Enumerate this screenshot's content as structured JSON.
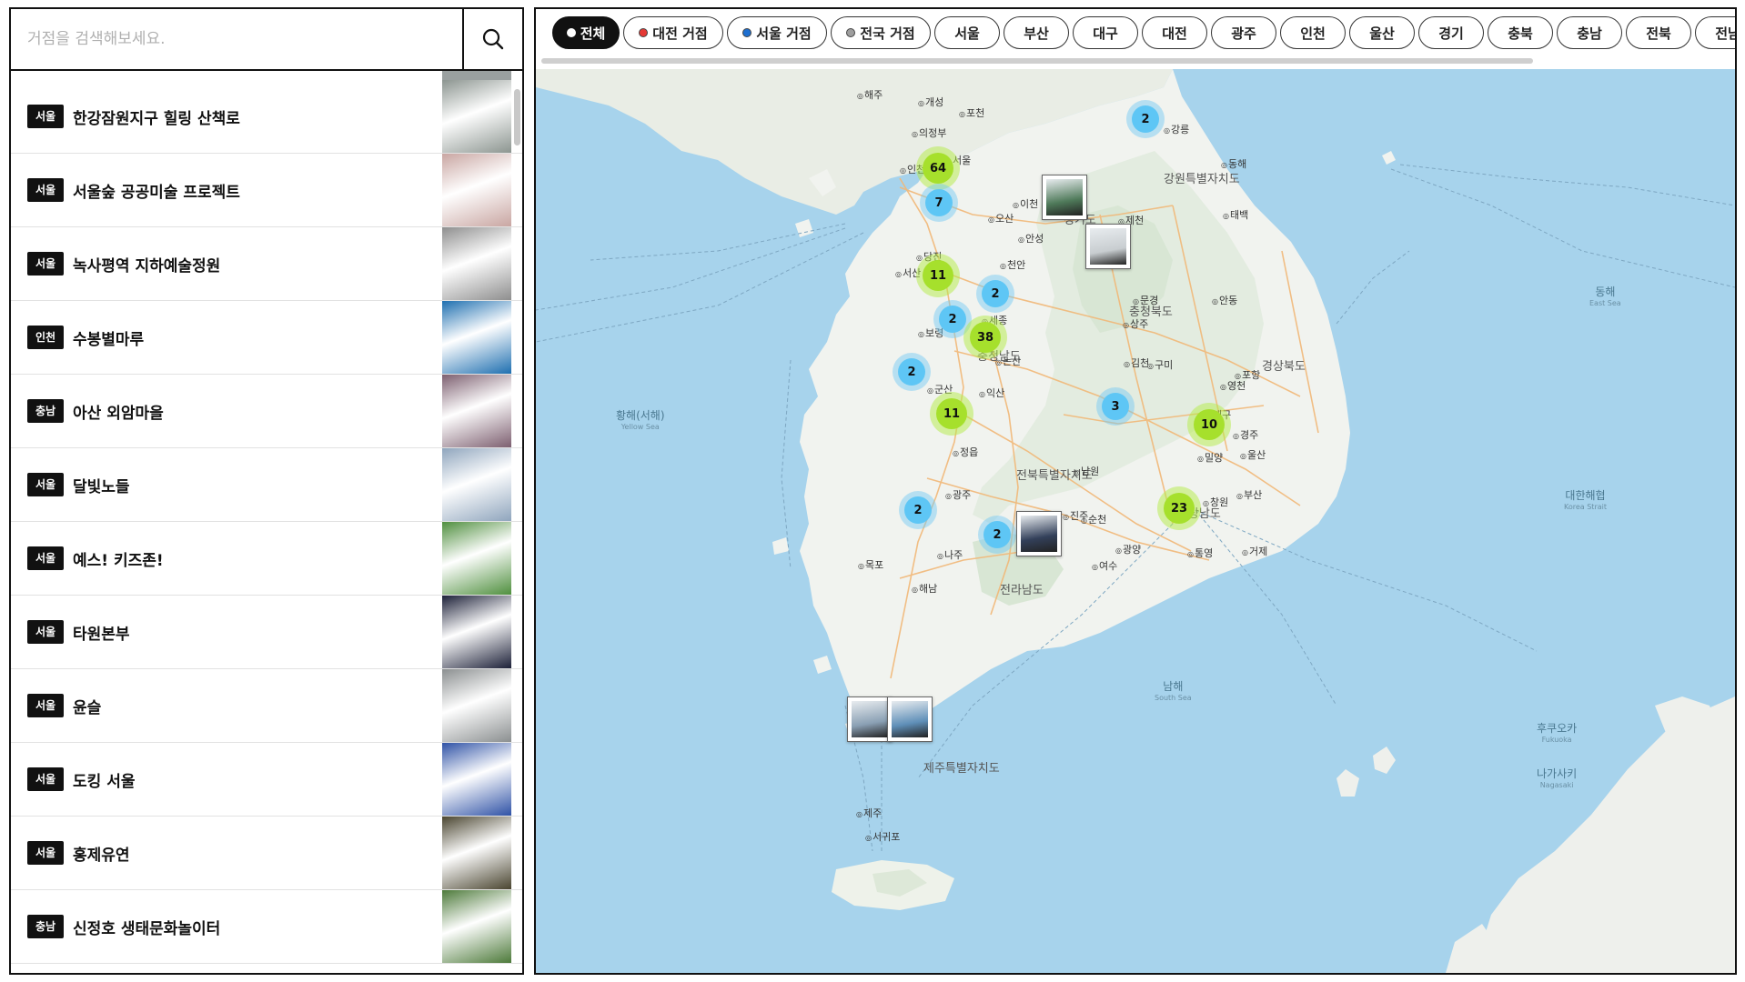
{
  "search": {
    "placeholder": "거점을 검색해보세요.",
    "button_icon": "search-icon"
  },
  "list_items": [
    {
      "region": "서울",
      "name": "한강잠원지구 힐링 산책로",
      "thumb": "#8c9590"
    },
    {
      "region": "서울",
      "name": "서울숲 공공미술 프로젝트",
      "thumb": "#c9a6a2"
    },
    {
      "region": "서울",
      "name": "녹사평역 지하예술정원",
      "thumb": "#8e8e8e"
    },
    {
      "region": "인천",
      "name": "수봉별마루",
      "thumb": "#1e6fb0"
    },
    {
      "region": "충남",
      "name": "아산 외암마을",
      "thumb": "#7d5f70"
    },
    {
      "region": "서울",
      "name": "달빛노들",
      "thumb": "#8fa5bd"
    },
    {
      "region": "서울",
      "name": "예스! 키즈존!",
      "thumb": "#4f8f3e"
    },
    {
      "region": "서울",
      "name": "타원본부",
      "thumb": "#1c2038"
    },
    {
      "region": "서울",
      "name": "윤슬",
      "thumb": "#8b8f90"
    },
    {
      "region": "서울",
      "name": "도킹 서울",
      "thumb": "#2f52a6"
    },
    {
      "region": "서울",
      "name": "홍제유연",
      "thumb": "#4a4530"
    },
    {
      "region": "충남",
      "name": "신정호 생태문화놀이터",
      "thumb": "#4d7a3a"
    }
  ],
  "filters": [
    {
      "label": "전체",
      "active": true,
      "dot": "#ffffff"
    },
    {
      "label": "대전 거점",
      "dot": "#e53935"
    },
    {
      "label": "서울 거점",
      "dot": "#1e6fd0"
    },
    {
      "label": "전국 거점",
      "dot": "#9e9e9e"
    },
    {
      "label": "서울"
    },
    {
      "label": "부산"
    },
    {
      "label": "대구"
    },
    {
      "label": "대전"
    },
    {
      "label": "광주"
    },
    {
      "label": "인천"
    },
    {
      "label": "울산"
    },
    {
      "label": "경기"
    },
    {
      "label": "충북"
    },
    {
      "label": "충남"
    },
    {
      "label": "전북"
    },
    {
      "label": "전남"
    }
  ],
  "clusters": [
    {
      "count": "64",
      "color": "green"
    },
    {
      "count": "7",
      "color": "blue"
    },
    {
      "count": "2",
      "color": "blue"
    },
    {
      "count": "11",
      "color": "green"
    },
    {
      "count": "2",
      "color": "blue"
    },
    {
      "count": "2",
      "color": "blue"
    },
    {
      "count": "38",
      "color": "green"
    },
    {
      "count": "2",
      "color": "blue"
    },
    {
      "count": "11",
      "color": "green"
    },
    {
      "count": "3",
      "color": "blue"
    },
    {
      "count": "10",
      "color": "green"
    },
    {
      "count": "23",
      "color": "green"
    },
    {
      "count": "2",
      "color": "blue"
    },
    {
      "count": "2",
      "color": "blue"
    }
  ],
  "map_labels": {
    "regions": [
      "강원특별자치도",
      "경기도",
      "충청북도",
      "충청남도",
      "경상북도",
      "전북특별자치도",
      "경상남도",
      "전라남도",
      "제주특별자치도"
    ],
    "seas": [
      {
        "name": "황해(서해)",
        "en": "Yellow Sea"
      },
      {
        "name": "동해",
        "en": "East Sea"
      },
      {
        "name": "남해",
        "en": "South Sea"
      },
      {
        "name": "대한해협",
        "en": "Korea Strait"
      },
      {
        "name": "후쿠오카",
        "en": "Fukuoka"
      },
      {
        "name": "나가사키",
        "en": "Nagasaki"
      }
    ],
    "cities": [
      "개성",
      "해주",
      "인천",
      "포천",
      "의정부",
      "강릉",
      "동해",
      "태백",
      "제천",
      "충주",
      "이천",
      "안성",
      "천안",
      "오산",
      "당진",
      "서산",
      "보령",
      "논산",
      "군산",
      "익산",
      "세종",
      "문경",
      "상주",
      "안동",
      "영천",
      "포항",
      "경주",
      "구미",
      "김천",
      "대구",
      "밀양",
      "울산",
      "창원",
      "거제",
      "통영",
      "진주",
      "여수",
      "광양",
      "순천",
      "나주",
      "목포",
      "해남",
      "남원",
      "정읍",
      "제주",
      "서귀포",
      "부산",
      "광주",
      "서울"
    ]
  }
}
